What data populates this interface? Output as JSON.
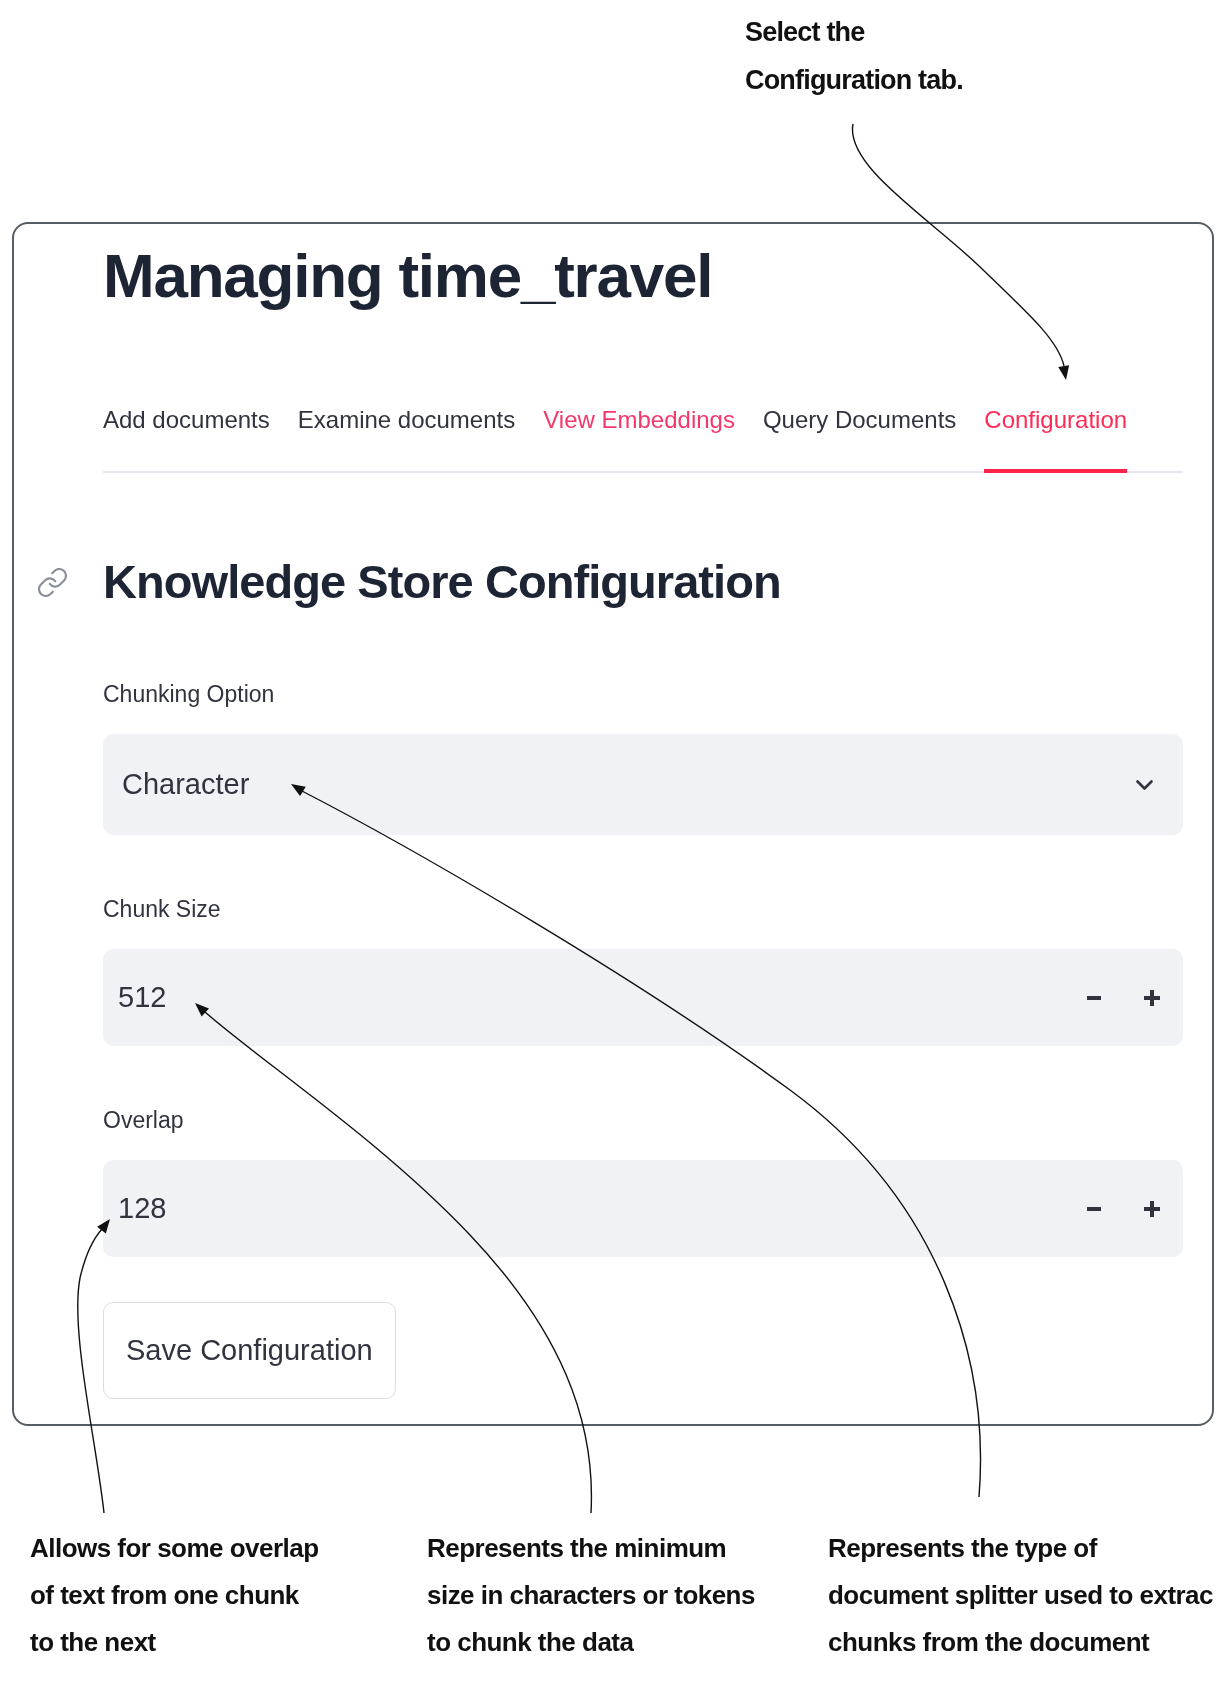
{
  "top_note": {
    "lines": [
      "Select the",
      "Configuration tab."
    ]
  },
  "panel": {
    "title": "Managing time_travel",
    "tabs": [
      {
        "label": "Add documents",
        "selected": false,
        "hovered": false
      },
      {
        "label": "Examine documents",
        "selected": false,
        "hovered": false
      },
      {
        "label": "View Embeddings",
        "selected": false,
        "hovered": true
      },
      {
        "label": "Query Documents",
        "selected": false,
        "hovered": false
      },
      {
        "label": "Configuration",
        "selected": true,
        "hovered": false
      }
    ],
    "section_title": "Knowledge Store Configuration",
    "fields": [
      {
        "kind": "select",
        "label": "Chunking Option",
        "value": "Character"
      },
      {
        "kind": "number",
        "label": "Chunk Size",
        "value": "512"
      },
      {
        "kind": "number",
        "label": "Overlap",
        "value": "128"
      }
    ],
    "save_button": "Save Configuration"
  },
  "bottom_notes": [
    {
      "lines": [
        "Allows for some overlap",
        "of text from one chunk",
        "to the next"
      ]
    },
    {
      "lines": [
        "Represents the minimum",
        "size in characters or tokens",
        "to chunk the data"
      ]
    },
    {
      "lines": [
        "Represents the type of",
        "document splitter used to extrac",
        "chunks from the document"
      ]
    }
  ]
}
